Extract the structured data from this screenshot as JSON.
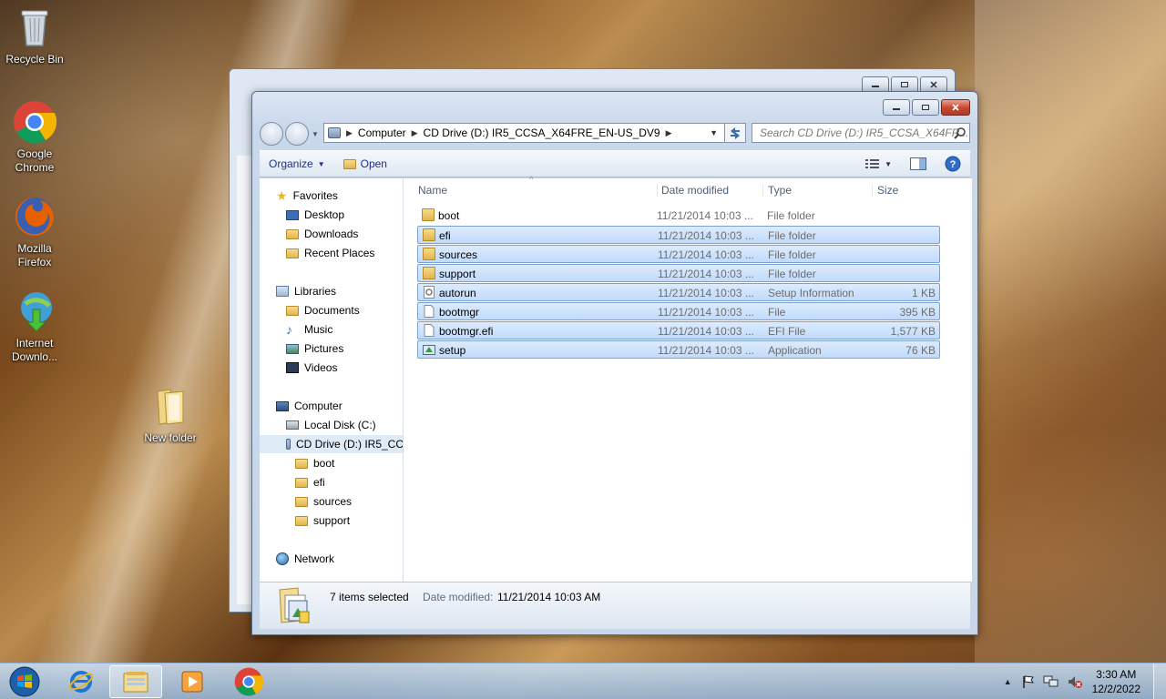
{
  "desktop": {
    "icons": [
      {
        "label": "Recycle Bin"
      },
      {
        "label": "Google Chrome"
      },
      {
        "label": "Mozilla Firefox"
      },
      {
        "label": "Internet Downlo..."
      },
      {
        "label": "New folder"
      }
    ]
  },
  "explorer": {
    "address": {
      "crumbs": [
        "Computer",
        "CD Drive (D:) IR5_CCSA_X64FRE_EN-US_DV9"
      ]
    },
    "search_placeholder": "Search CD Drive (D:) IR5_CCSA_X64FR...",
    "toolbar": {
      "organize_label": "Organize",
      "open_label": "Open"
    },
    "nav_pane": {
      "favorites": "Favorites",
      "desktop": "Desktop",
      "downloads": "Downloads",
      "recent": "Recent Places",
      "libraries": "Libraries",
      "documents": "Documents",
      "music": "Music",
      "pictures": "Pictures",
      "videos": "Videos",
      "computer": "Computer",
      "local_disk": "Local Disk (C:)",
      "cd_drive": "CD Drive (D:) IR5_CC",
      "sub_boot": "boot",
      "sub_efi": "efi",
      "sub_sources": "sources",
      "sub_support": "support",
      "network": "Network"
    },
    "columns": {
      "name": "Name",
      "date": "Date modified",
      "type": "Type",
      "size": "Size"
    },
    "files": [
      {
        "name": "boot",
        "date": "11/21/2014 10:03 ...",
        "type": "File folder",
        "size": ""
      },
      {
        "name": "efi",
        "date": "11/21/2014 10:03 ...",
        "type": "File folder",
        "size": ""
      },
      {
        "name": "sources",
        "date": "11/21/2014 10:03 ...",
        "type": "File folder",
        "size": ""
      },
      {
        "name": "support",
        "date": "11/21/2014 10:03 ...",
        "type": "File folder",
        "size": ""
      },
      {
        "name": "autorun",
        "date": "11/21/2014 10:03 ...",
        "type": "Setup Information",
        "size": "1 KB"
      },
      {
        "name": "bootmgr",
        "date": "11/21/2014 10:03 ...",
        "type": "File",
        "size": "395 KB"
      },
      {
        "name": "bootmgr.efi",
        "date": "11/21/2014 10:03 ...",
        "type": "EFI File",
        "size": "1,577 KB"
      },
      {
        "name": "setup",
        "date": "11/21/2014 10:03 ...",
        "type": "Application",
        "size": "76 KB"
      }
    ],
    "details": {
      "selected": "7 items selected",
      "date_label": "Date modified:",
      "date_value": "11/21/2014 10:03 AM"
    }
  },
  "taskbar": {
    "clock_time": "3:30 AM",
    "clock_date": "12/2/2022"
  },
  "colors": {
    "selection_bg": "#c1dbfc",
    "selection_border": "#7da2ce",
    "link_blue": "#1e3287",
    "close_red": "#c74a33"
  }
}
